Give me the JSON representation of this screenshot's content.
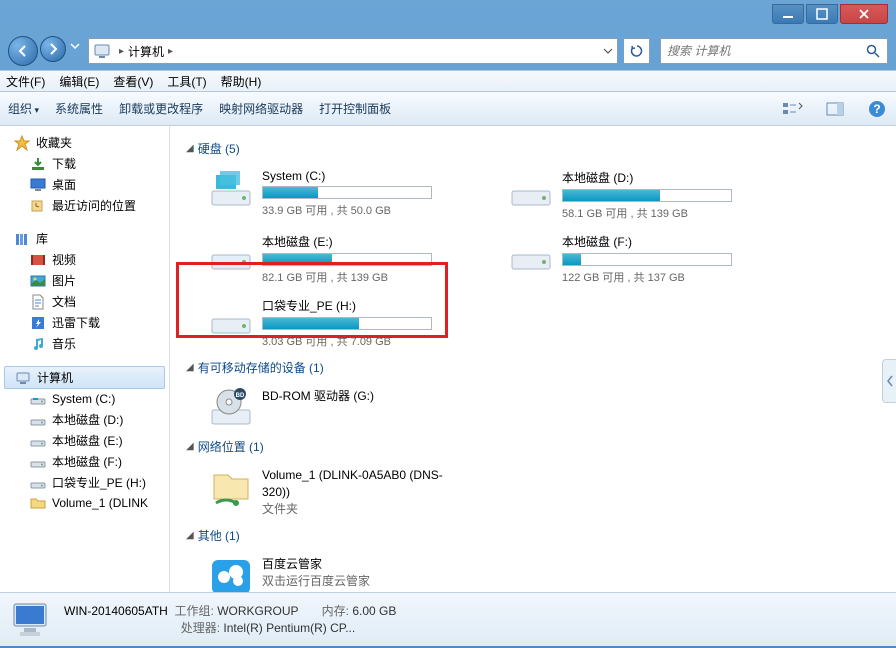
{
  "breadcrumb": {
    "label": "计算机",
    "search_placeholder": "搜索 计算机"
  },
  "menubar": {
    "file": "文件(F)",
    "edit": "编辑(E)",
    "view": "查看(V)",
    "tools": "工具(T)",
    "help": "帮助(H)"
  },
  "toolbar": {
    "organize": "组织",
    "props": "系统属性",
    "uninstall": "卸载或更改程序",
    "mapnet": "映射网络驱动器",
    "ctrlpanel": "打开控制面板"
  },
  "sidebar": {
    "favorites": {
      "title": "收藏夹",
      "items": [
        "下载",
        "桌面",
        "最近访问的位置"
      ]
    },
    "libraries": {
      "title": "库",
      "items": [
        "视频",
        "图片",
        "文档",
        "迅雷下载",
        "音乐"
      ]
    },
    "computer": {
      "title": "计算机",
      "items": [
        "System (C:)",
        "本地磁盘 (D:)",
        "本地磁盘 (E:)",
        "本地磁盘 (F:)",
        "口袋专业_PE (H:)",
        "Volume_1 (DLINK"
      ]
    }
  },
  "sections": {
    "drives": {
      "title": "硬盘 (5)",
      "items": [
        {
          "name": "System (C:)",
          "free": "33.9 GB 可用 , 共 50.0 GB",
          "pct": 33
        },
        {
          "name": "本地磁盘 (D:)",
          "free": "58.1 GB 可用 , 共 139 GB",
          "pct": 58
        },
        {
          "name": "本地磁盘 (E:)",
          "free": "82.1 GB 可用 , 共 139 GB",
          "pct": 41
        },
        {
          "name": "本地磁盘 (F:)",
          "free": "122 GB 可用 , 共 137 GB",
          "pct": 11
        },
        {
          "name": "口袋专业_PE (H:)",
          "free": "3.03 GB 可用 , 共 7.09 GB",
          "pct": 57
        }
      ]
    },
    "removable": {
      "title": "有可移动存储的设备 (1)",
      "item": "BD-ROM 驱动器 (G:)"
    },
    "network": {
      "title": "网络位置 (1)",
      "item": "Volume_1 (DLINK-0A5AB0 (DNS-320))",
      "sub": "文件夹"
    },
    "other": {
      "title": "其他 (1)",
      "item": "百度云管家",
      "sub": "双击运行百度云管家"
    }
  },
  "details": {
    "name": "WIN-20140605ATH",
    "wg_label": "工作组:",
    "wg": "WORKGROUP",
    "mem_label": "内存:",
    "mem": "6.00 GB",
    "cpu_label": "处理器:",
    "cpu": "Intel(R) Pentium(R) CP..."
  }
}
